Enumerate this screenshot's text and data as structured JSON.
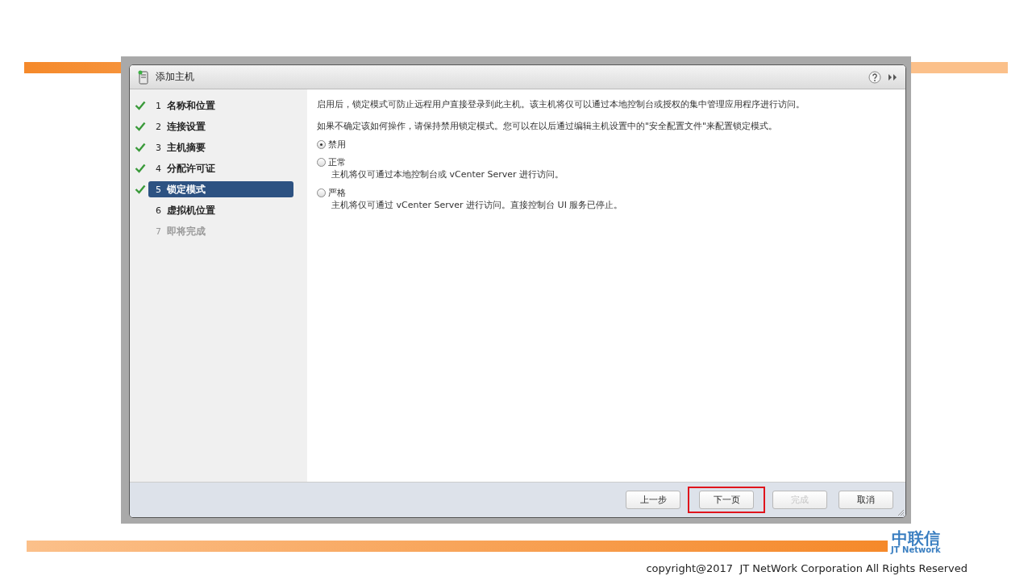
{
  "window": {
    "title": "添加主机"
  },
  "steps": [
    {
      "number": "1",
      "label": "名称和位置",
      "done": true,
      "selected": false,
      "disabled": false
    },
    {
      "number": "2",
      "label": "连接设置",
      "done": true,
      "selected": false,
      "disabled": false
    },
    {
      "number": "3",
      "label": "主机摘要",
      "done": true,
      "selected": false,
      "disabled": false
    },
    {
      "number": "4",
      "label": "分配许可证",
      "done": true,
      "selected": false,
      "disabled": false
    },
    {
      "number": "5",
      "label": "锁定模式",
      "done": true,
      "selected": true,
      "disabled": false
    },
    {
      "number": "6",
      "label": "虚拟机位置",
      "done": false,
      "selected": false,
      "disabled": false
    },
    {
      "number": "7",
      "label": "即将完成",
      "done": false,
      "selected": false,
      "disabled": true
    }
  ],
  "content": {
    "paragraphs": [
      "启用后，锁定模式可防止远程用户直接登录到此主机。该主机将仅可以通过本地控制台或授权的集中管理应用程序进行访问。",
      "如果不确定该如何操作，请保持禁用锁定模式。您可以在以后通过编辑主机设置中的\"安全配置文件\"来配置锁定模式。"
    ],
    "options": [
      {
        "label": "禁用",
        "selected": true
      },
      {
        "label": "正常",
        "selected": false,
        "description": "主机将仅可通过本地控制台或 vCenter Server 进行访问。"
      },
      {
        "label": "严格",
        "selected": false,
        "description": "主机将仅可通过 vCenter Server 进行访问。直接控制台 UI 服务已停止。"
      }
    ]
  },
  "buttons": [
    {
      "label": "上一步",
      "disabled": false,
      "highlighted": false
    },
    {
      "label": "下一页",
      "disabled": false,
      "highlighted": true
    },
    {
      "label": "完成",
      "disabled": true,
      "highlighted": false
    },
    {
      "label": "取消",
      "disabled": false,
      "highlighted": false
    }
  ],
  "slide": {
    "logo": "中联信",
    "logo_subtitle": "JT Network",
    "copyright": "copyright@2017  JT NetWork Corporation All Rights Reserved"
  }
}
